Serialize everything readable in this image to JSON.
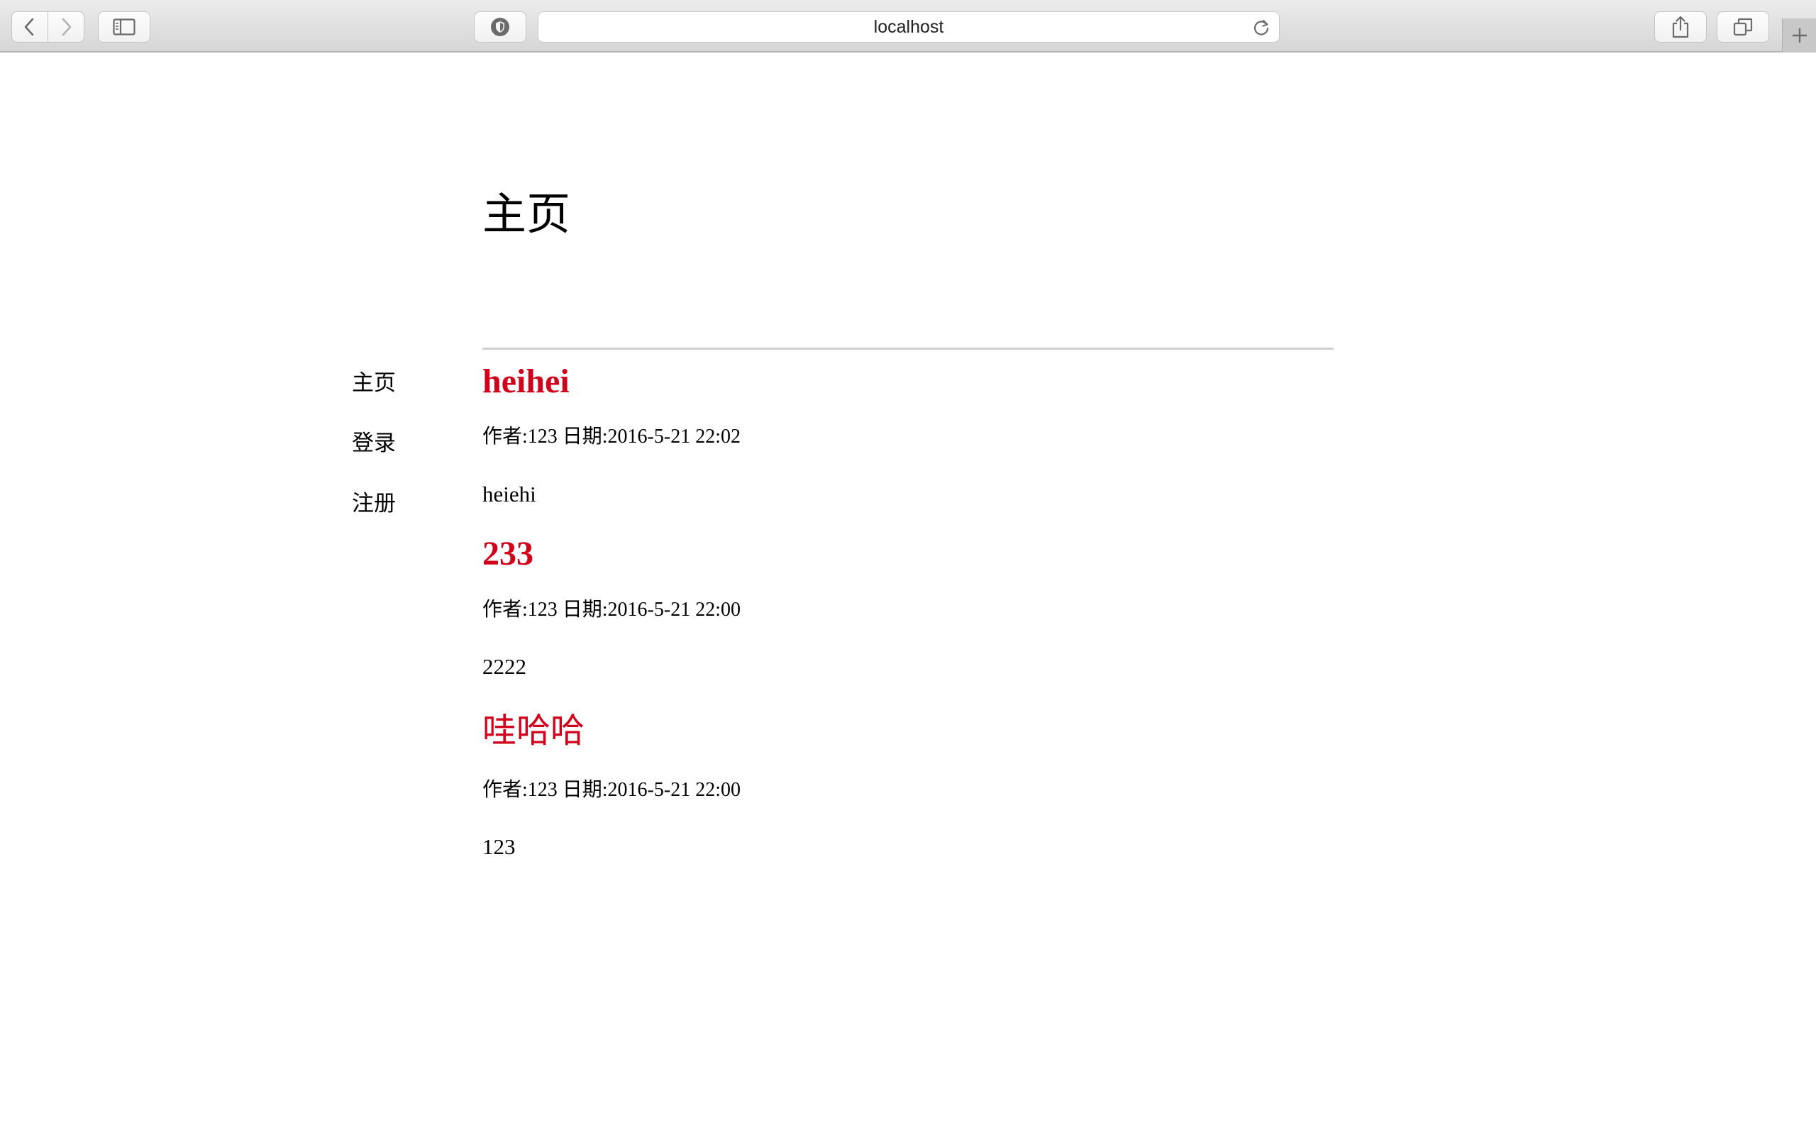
{
  "browser": {
    "address": "localhost"
  },
  "page": {
    "heading": "主页"
  },
  "nav": {
    "items": [
      {
        "label": "主页"
      },
      {
        "label": "登录"
      },
      {
        "label": "注册"
      }
    ]
  },
  "posts": [
    {
      "title": "heihei",
      "meta": "作者:123 日期:2016-5-21 22:02",
      "body": "heiehi"
    },
    {
      "title": "233",
      "meta": "作者:123 日期:2016-5-21 22:00",
      "body": "2222"
    },
    {
      "title": "哇哈哈",
      "meta": "作者:123 日期:2016-5-21 22:00",
      "body": "123"
    }
  ],
  "colors": {
    "title": "#d0021b",
    "text": "#000000",
    "divider": "#d0d0d0"
  }
}
